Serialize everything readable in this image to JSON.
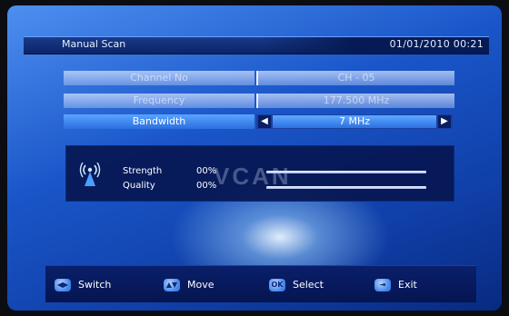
{
  "header": {
    "title": "Manual Scan",
    "datetime": "01/01/2010 00:21"
  },
  "fields": [
    {
      "label": "Channel No",
      "value": "CH - 05"
    },
    {
      "label": "Frequency",
      "value": "177.500 MHz"
    },
    {
      "label": "Bandwidth",
      "value": "7 MHz"
    }
  ],
  "signal": {
    "strength_label": "Strength",
    "strength_value": "00%",
    "strength_level": 0,
    "quality_label": "Quality",
    "quality_value": "00%",
    "quality_level": 0,
    "watermark": "VCAN"
  },
  "footer": [
    {
      "label": "Switch",
      "icon": "left-right-arrows-icon"
    },
    {
      "label": "Move",
      "icon": "up-down-arrows-icon"
    },
    {
      "label": "Select",
      "icon": "ok-icon",
      "key_text": "OK"
    },
    {
      "label": "Exit",
      "icon": "exit-icon"
    }
  ],
  "colors": {
    "background": "#1a56c9",
    "header": "#0b2466",
    "highlight": "#3f87f0",
    "panel": "#061650"
  }
}
